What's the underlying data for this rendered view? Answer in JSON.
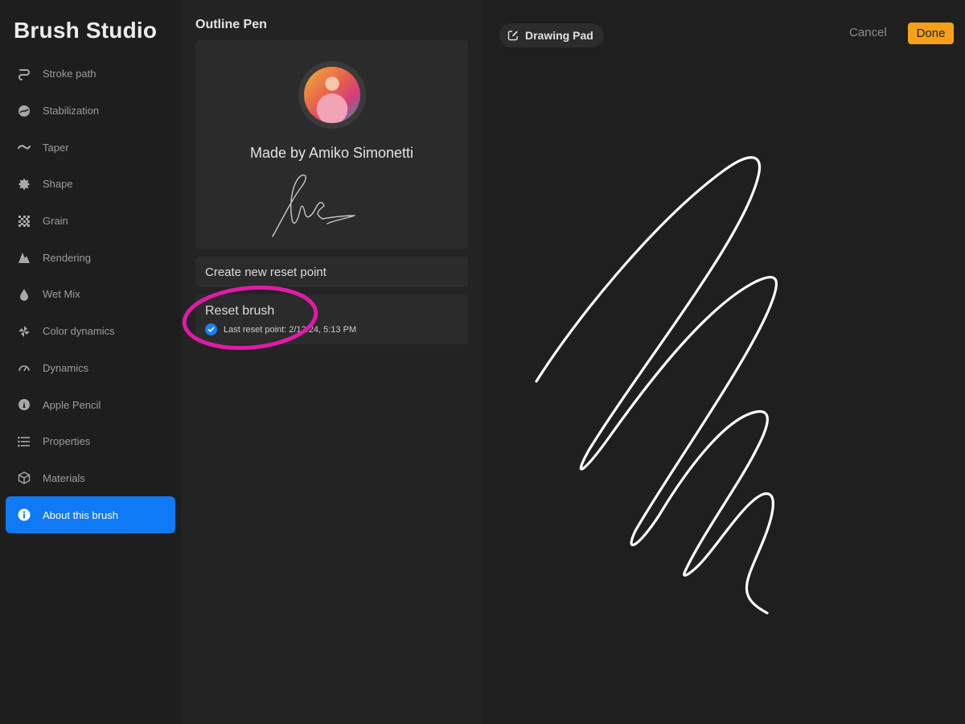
{
  "app": {
    "title": "Brush Studio"
  },
  "sidebar": {
    "items": [
      {
        "label": "Stroke path",
        "icon": "stroke-path-icon"
      },
      {
        "label": "Stabilization",
        "icon": "stabilization-icon"
      },
      {
        "label": "Taper",
        "icon": "taper-icon"
      },
      {
        "label": "Shape",
        "icon": "shape-icon"
      },
      {
        "label": "Grain",
        "icon": "grain-icon"
      },
      {
        "label": "Rendering",
        "icon": "rendering-icon"
      },
      {
        "label": "Wet Mix",
        "icon": "wet-mix-icon"
      },
      {
        "label": "Color dynamics",
        "icon": "color-dynamics-icon"
      },
      {
        "label": "Dynamics",
        "icon": "dynamics-icon"
      },
      {
        "label": "Apple Pencil",
        "icon": "apple-pencil-icon"
      },
      {
        "label": "Properties",
        "icon": "properties-icon"
      },
      {
        "label": "Materials",
        "icon": "materials-icon"
      },
      {
        "label": "About this brush",
        "icon": "info-icon",
        "active": true
      }
    ],
    "accent": "#1079f5"
  },
  "about": {
    "brush_name": "Outline Pen",
    "made_by": "Made by Amiko Simonetti",
    "create_reset_point": "Create new reset point",
    "reset_brush": "Reset brush",
    "last_reset_point": "Last reset point: 2/12/24, 5:13 PM",
    "highlight_color": "#e01aa8"
  },
  "pad": {
    "title": "Drawing Pad",
    "cancel_label": "Cancel",
    "done_label": "Done",
    "done_color": "#f6a017"
  }
}
